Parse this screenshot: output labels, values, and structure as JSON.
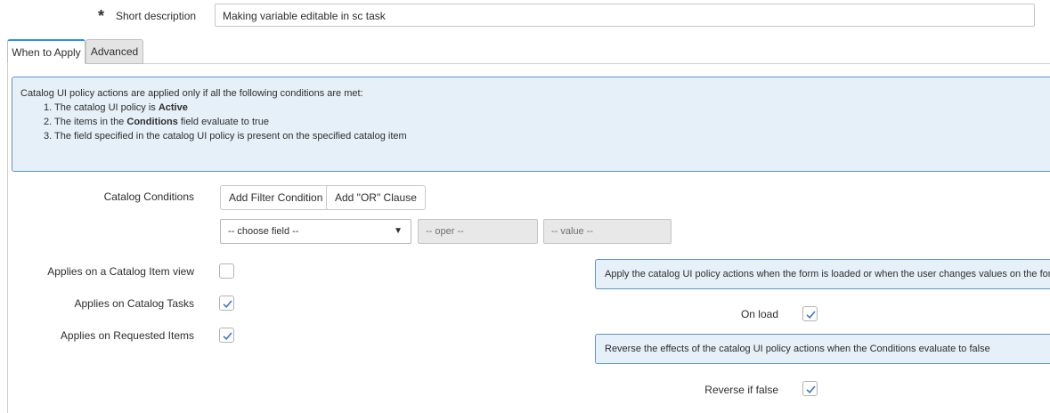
{
  "short_description": {
    "required_marker": "*",
    "label": "Short description",
    "value": "Making variable editable in sc task"
  },
  "tabs": [
    {
      "label": "When to Apply",
      "active": true
    },
    {
      "label": "Advanced",
      "active": false
    }
  ],
  "info": {
    "intro": "Catalog UI policy actions are applied only if all the following conditions are met:",
    "items": [
      {
        "num": "1.",
        "pre": "The catalog UI policy is ",
        "bold": "Active",
        "post": ""
      },
      {
        "num": "2.",
        "pre": "The items in the ",
        "bold": "Conditions",
        "post": " field evaluate to true"
      },
      {
        "num": "3.",
        "pre": "The field specified in the catalog UI policy is present on the specified catalog item",
        "bold": "",
        "post": ""
      }
    ]
  },
  "conditions": {
    "label": "Catalog Conditions",
    "add_filter_label": "Add Filter Condition",
    "add_or_label": "Add \"OR\" Clause",
    "field_placeholder": "-- choose field --",
    "field_arrow": "▼",
    "oper_placeholder": "-- oper --",
    "value_placeholder": "-- value --"
  },
  "applies": {
    "catalog_item_view": {
      "label": "Applies on a Catalog Item view",
      "checked": false
    },
    "catalog_tasks": {
      "label": "Applies on Catalog Tasks",
      "checked": true
    },
    "requested_items": {
      "label": "Applies on Requested Items",
      "checked": true
    }
  },
  "on_load": {
    "hint": "Apply the catalog UI policy actions when the form is loaded or when the user changes values on the form",
    "label": "On load",
    "checked": true
  },
  "reverse": {
    "hint": "Reverse the effects of the catalog UI policy actions when the Conditions evaluate to false",
    "label": "Reverse if false",
    "checked": true
  },
  "colors": {
    "accent": "#278efc",
    "info_bg": "#e6f0f9",
    "info_border": "#5b93d0",
    "check": "#3a79c4"
  }
}
